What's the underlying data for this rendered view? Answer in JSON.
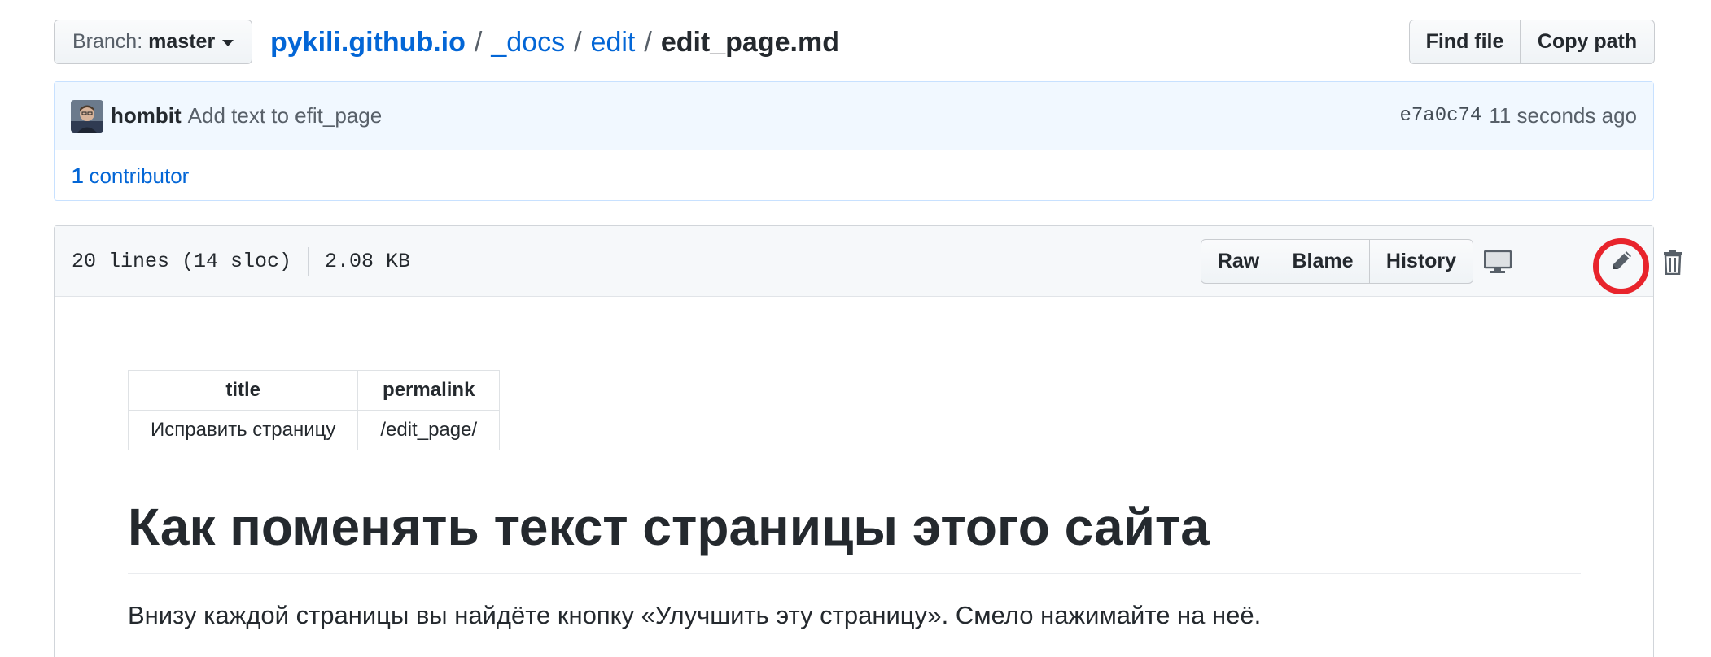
{
  "branch": {
    "label": "Branch:",
    "value": "master"
  },
  "breadcrumb": {
    "repo": "pykili.github.io",
    "parts": [
      "_docs",
      "edit"
    ],
    "file": "edit_page.md",
    "separator": "/"
  },
  "top_buttons": {
    "find_file": "Find file",
    "copy_path": "Copy path"
  },
  "commit": {
    "author": "hombit",
    "message": "Add text to efit_page",
    "sha": "e7a0c74",
    "time": "11 seconds ago"
  },
  "contributors": {
    "count": "1",
    "label": "contributor"
  },
  "file": {
    "lines": "20 lines (14 sloc)",
    "size": "2.08 KB",
    "buttons": {
      "raw": "Raw",
      "blame": "Blame",
      "history": "History"
    },
    "icons": {
      "desktop": "desktop-icon",
      "edit": "pencil-icon",
      "delete": "trash-icon"
    },
    "highlight_color": "#e8242c"
  },
  "content": {
    "table": {
      "headers": [
        "title",
        "permalink"
      ],
      "row": [
        "Исправить страницу",
        "/edit_page/"
      ]
    },
    "heading": "Как поменять текст страницы этого сайта",
    "paragraph": "Внизу каждой страницы вы найдёте кнопку «Улучшить эту страницу». Смело нажимайте на неё."
  }
}
